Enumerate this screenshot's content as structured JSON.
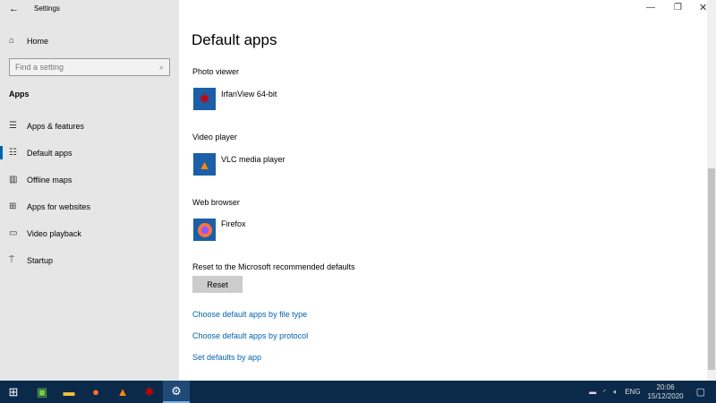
{
  "window": {
    "title": "Settings"
  },
  "sidebar": {
    "home": "Home",
    "search_placeholder": "Find a setting",
    "section": "Apps",
    "items": [
      {
        "label": "Apps & features",
        "icon": "list-icon"
      },
      {
        "label": "Default apps",
        "icon": "default-apps-icon"
      },
      {
        "label": "Offline maps",
        "icon": "map-icon"
      },
      {
        "label": "Apps for websites",
        "icon": "websites-icon"
      },
      {
        "label": "Video playback",
        "icon": "video-icon"
      },
      {
        "label": "Startup",
        "icon": "startup-icon"
      }
    ]
  },
  "main": {
    "title": "Default apps",
    "defaults": [
      {
        "category": "Photo viewer",
        "app": "IrfanView 64-bit"
      },
      {
        "category": "Video player",
        "app": "VLC media player"
      },
      {
        "category": "Web browser",
        "app": "Firefox"
      }
    ],
    "reset_label": "Reset to the Microsoft recommended defaults",
    "reset_button": "Reset",
    "links": [
      "Choose default apps by file type",
      "Choose default apps by protocol",
      "Set defaults by app"
    ]
  },
  "taskbar": {
    "time": "20:06",
    "date": "15/12/2020",
    "lang": "ENG"
  },
  "colors": {
    "accent": "#0063b1",
    "taskbar": "#0b2a4a"
  }
}
